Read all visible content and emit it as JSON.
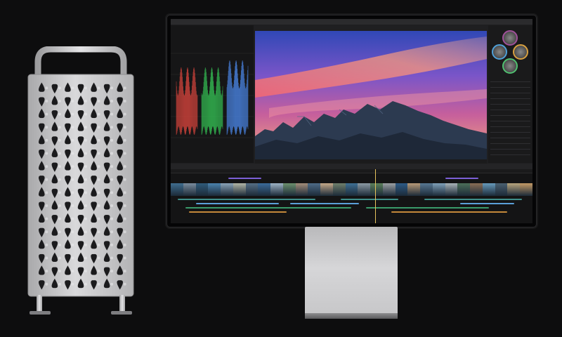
{
  "tower": {
    "grille_rows": 16,
    "grille_cols": 7
  },
  "app": {
    "window_title": "",
    "viewer_title": "",
    "timecode": "",
    "timeline_title": ""
  },
  "colors": {
    "background": "#0d0d0e",
    "aluminum": "#c8c8ca",
    "sky_top": "#3e56c2",
    "sky_glow": "#e46a7a",
    "rock": "#2b3546",
    "playhead": "#e6c35c",
    "scope_red": "#d8453d",
    "scope_green": "#35c154",
    "scope_blue": "#4b86e6"
  },
  "timeline": {
    "clip_colors": [
      "#3f6d8f",
      "#7a8c9e",
      "#2f5a7a",
      "#4a82ad",
      "#8aa3b8",
      "#b2b6a6",
      "#556e84",
      "#3b6b9a",
      "#9eb3c6",
      "#6b8f6c",
      "#a38d7a",
      "#4e6b87",
      "#c5a98a",
      "#6f7f6b",
      "#3e6f94",
      "#8c9aa4",
      "#5a7f5a",
      "#9ca0a4",
      "#2d5a86",
      "#b89a78",
      "#587893",
      "#7fa0b9",
      "#a9b3b8",
      "#4c6f59",
      "#8a6d55",
      "#6699bb",
      "#4a5f70",
      "#b8a57e",
      "#c49a66"
    ],
    "lanes": [
      {
        "color": "#7b5fd6",
        "segments": [
          [
            0.16,
            0.25
          ],
          [
            0.76,
            0.85
          ]
        ]
      },
      {
        "color": "#3e8f8a",
        "segments": [
          [
            0.02,
            0.4
          ],
          [
            0.47,
            0.63
          ],
          [
            0.7,
            0.97
          ]
        ]
      },
      {
        "color": "#5aa0d8",
        "segments": [
          [
            0.07,
            0.3
          ],
          [
            0.33,
            0.52
          ],
          [
            0.8,
            0.95
          ]
        ]
      },
      {
        "color": "#3a9a6a",
        "segments": [
          [
            0.04,
            0.5
          ],
          [
            0.54,
            0.88
          ]
        ]
      },
      {
        "color": "#c4883a",
        "segments": [
          [
            0.05,
            0.32
          ],
          [
            0.61,
            0.93
          ]
        ]
      }
    ]
  }
}
